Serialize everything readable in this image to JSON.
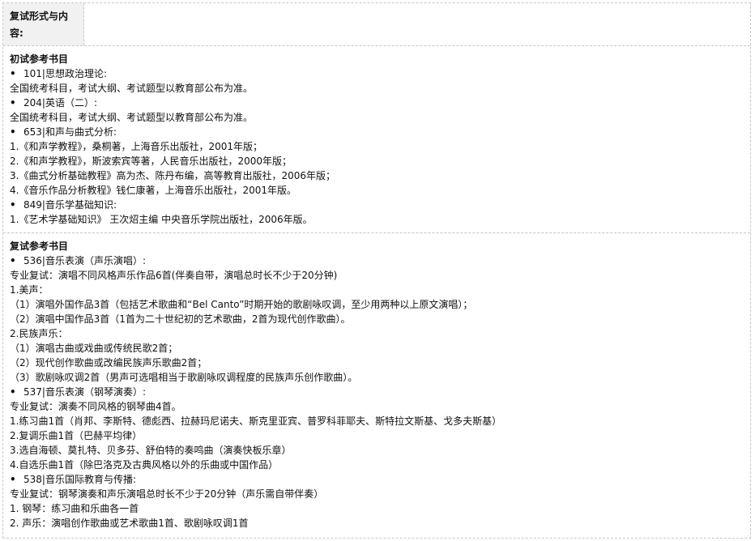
{
  "top_row": {
    "label_line1": "复试形式与内",
    "label_line2": "容:"
  },
  "initial": {
    "heading": "初试参考书目",
    "lines": [
      {
        "type": "bullet",
        "text": "101|思想政治理论:"
      },
      {
        "type": "text",
        "text": "全国统考科目，考试大纲、考试题型以教育部公布为准。"
      },
      {
        "type": "bullet",
        "text": "204|英语（二）:"
      },
      {
        "type": "text",
        "text": "全国统考科目，考试大纲、考试题型以教育部公布为准。"
      },
      {
        "type": "bullet",
        "text": "653|和声与曲式分析:"
      },
      {
        "type": "text",
        "text": "1.《和声学教程》，桑桐著，上海音乐出版社，2001年版；"
      },
      {
        "type": "text",
        "text": "2.《和声学教程》，斯波索宾等著，人民音乐出版社，2000年版；"
      },
      {
        "type": "text",
        "text": "3.《曲式分析基础教程》高为杰、陈丹布编，高等教育出版社，2006年版；"
      },
      {
        "type": "text",
        "text": "4.《音乐作品分析教程》钱仁康著，上海音乐出版社，2001年版。"
      },
      {
        "type": "bullet",
        "text": "849|音乐学基础知识:"
      },
      {
        "type": "text",
        "text": "1.《艺术学基础知识》 王次炤主编 中央音乐学院出版社，2006年版。"
      }
    ]
  },
  "retest": {
    "heading": "复试参考书目",
    "lines": [
      {
        "type": "bullet",
        "text": "536|音乐表演（声乐演唱）:"
      },
      {
        "type": "text",
        "text": "专业复试：演唱不同风格声乐作品6首(伴奏自带，演唱总时长不少于20分钟)"
      },
      {
        "type": "text",
        "text": "1.美声："
      },
      {
        "type": "text",
        "text": "（1）演唱外国作品3首（包括艺术歌曲和“Bel Canto”时期开始的歌剧咏叹调，至少用两种以上原文演唱）；"
      },
      {
        "type": "text",
        "text": "（2）演唱中国作品3首（1首为二十世纪初的艺术歌曲，2首为现代创作歌曲）。"
      },
      {
        "type": "text",
        "text": "2.民族声乐："
      },
      {
        "type": "text",
        "text": "（1）演唱古曲或戏曲或传统民歌2首；"
      },
      {
        "type": "text",
        "text": "（2）现代创作歌曲或改编民族声乐歌曲2首；"
      },
      {
        "type": "text",
        "text": "（3）歌剧咏叹调2首（男声可选唱相当于歌剧咏叹调程度的民族声乐创作歌曲）。"
      },
      {
        "type": "bullet",
        "text": "537|音乐表演（钢琴演奏）:"
      },
      {
        "type": "text",
        "text": "专业复试：演奏不同风格的钢琴曲4首。"
      },
      {
        "type": "text",
        "text": "1.练习曲1首（肖邦、李斯特、德彪西、拉赫玛尼诺夫、斯克里亚宾、普罗科菲耶夫、斯特拉文斯基、戈多夫斯基）"
      },
      {
        "type": "text",
        "text": "2.复调乐曲1首（巴赫平均律）"
      },
      {
        "type": "text",
        "text": "3.选自海顿、莫扎特、贝多芬、舒伯特的奏鸣曲（演奏快板乐章）"
      },
      {
        "type": "text",
        "text": "4.自选乐曲1首（除巴洛克及古典风格以外的乐曲或中国作品）"
      },
      {
        "type": "bullet",
        "text": "538|音乐国际教育与传播:"
      },
      {
        "type": "text",
        "text": "专业复试：钢琴演奏和声乐演唱总时长不少于20分钟（声乐需自带伴奏）"
      },
      {
        "type": "text",
        "text": "1. 钢琴：练习曲和乐曲各一首"
      },
      {
        "type": "text",
        "text": "2. 声乐：演唱创作歌曲或艺术歌曲1首、歌剧咏叹调1首"
      }
    ]
  }
}
